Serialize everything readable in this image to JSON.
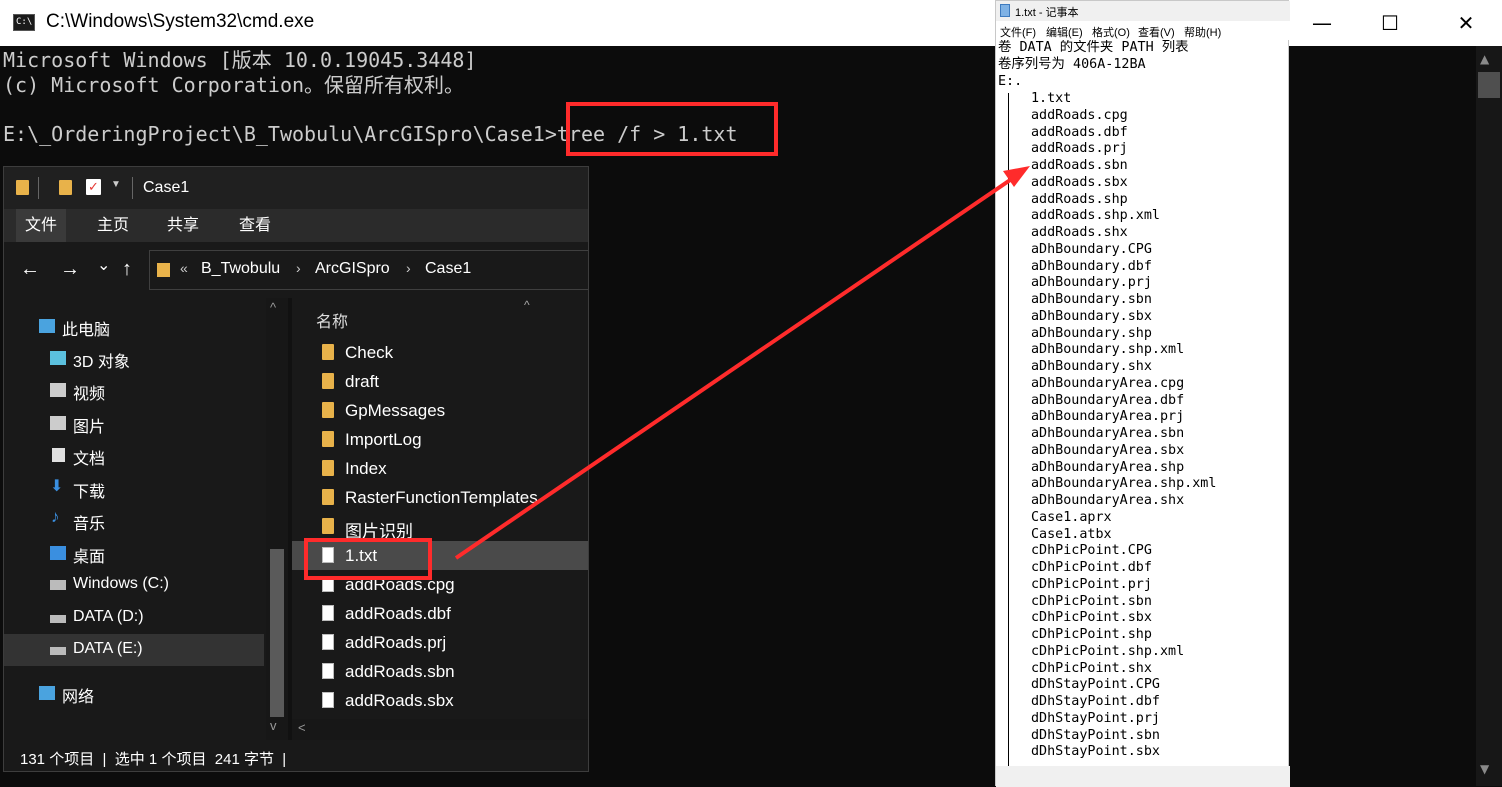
{
  "cmd": {
    "title": "C:\\Windows\\System32\\cmd.exe",
    "icon_text": "C:\\",
    "lines": [
      "Microsoft Windows [版本 10.0.19045.3448]",
      "(c) Microsoft Corporation。保留所有权利。",
      "",
      "E:\\_OrderingProject\\B_Twobulu\\ArcGISpro\\Case1>tree /f > 1.txt"
    ],
    "minimize": "—",
    "maximize": "☐",
    "close": "✕"
  },
  "explorer": {
    "title": "Case1",
    "ribbon": {
      "file": "文件",
      "home": "主页",
      "share": "共享",
      "view": "查看"
    },
    "nav": {
      "back": "←",
      "forward": "→",
      "recent": "⌄",
      "up": "↑"
    },
    "address": {
      "overflow": "«",
      "crumbs": [
        "B_Twobulu",
        "ArcGISpro",
        "Case1"
      ]
    },
    "nav_pane": [
      {
        "label": "此电脑",
        "icon": "pc-icon",
        "color": "#4aa3df"
      },
      {
        "label": "3D 对象",
        "icon": "3d-objects-icon",
        "color": "#5bc0de"
      },
      {
        "label": "视频",
        "icon": "video-icon",
        "color": "#cccccc"
      },
      {
        "label": "图片",
        "icon": "pictures-icon",
        "color": "#cccccc"
      },
      {
        "label": "文档",
        "icon": "documents-icon",
        "color": "#e0e0e0"
      },
      {
        "label": "下载",
        "icon": "downloads-icon",
        "color": "#3a8fe0"
      },
      {
        "label": "音乐",
        "icon": "music-icon",
        "color": "#3a8fe0"
      },
      {
        "label": "桌面",
        "icon": "desktop-icon",
        "color": "#3a8fe0"
      },
      {
        "label": "Windows (C:)",
        "icon": "drive-c-icon",
        "color": "#bbbbbb"
      },
      {
        "label": "DATA (D:)",
        "icon": "drive-d-icon",
        "color": "#bbbbbb"
      },
      {
        "label": "DATA (E:)",
        "icon": "drive-e-icon",
        "color": "#bbbbbb"
      },
      {
        "label": "网络",
        "icon": "network-icon",
        "color": "#4aa3df"
      }
    ],
    "column_name": "名称",
    "files": [
      {
        "name": "Check",
        "type": "folder"
      },
      {
        "name": "draft",
        "type": "folder"
      },
      {
        "name": "GpMessages",
        "type": "folder"
      },
      {
        "name": "ImportLog",
        "type": "folder"
      },
      {
        "name": "Index",
        "type": "folder"
      },
      {
        "name": "RasterFunctionTemplates",
        "type": "folder"
      },
      {
        "name": "图片识别",
        "type": "folder"
      },
      {
        "name": "1.txt",
        "type": "text"
      },
      {
        "name": "addRoads.cpg",
        "type": "file"
      },
      {
        "name": "addRoads.dbf",
        "type": "file"
      },
      {
        "name": "addRoads.prj",
        "type": "file"
      },
      {
        "name": "addRoads.sbn",
        "type": "file"
      },
      {
        "name": "addRoads.sbx",
        "type": "file"
      }
    ],
    "status": "131 个项目  |  选中 1 个项目  241 字节  |"
  },
  "notepad": {
    "title": "1.txt - 记事本",
    "menu": [
      "文件(F)",
      "编辑(E)",
      "格式(O)",
      "查看(V)",
      "帮助(H)"
    ],
    "header_lines": [
      "卷 DATA 的文件夹 PATH 列表",
      "卷序列号为 406A-12BA",
      "E:."
    ],
    "files": [
      "1.txt",
      "addRoads.cpg",
      "addRoads.dbf",
      "addRoads.prj",
      "addRoads.sbn",
      "addRoads.sbx",
      "addRoads.shp",
      "addRoads.shp.xml",
      "addRoads.shx",
      "aDhBoundary.CPG",
      "aDhBoundary.dbf",
      "aDhBoundary.prj",
      "aDhBoundary.sbn",
      "aDhBoundary.sbx",
      "aDhBoundary.shp",
      "aDhBoundary.shp.xml",
      "aDhBoundary.shx",
      "aDhBoundaryArea.cpg",
      "aDhBoundaryArea.dbf",
      "aDhBoundaryArea.prj",
      "aDhBoundaryArea.sbn",
      "aDhBoundaryArea.sbx",
      "aDhBoundaryArea.shp",
      "aDhBoundaryArea.shp.xml",
      "aDhBoundaryArea.shx",
      "Case1.aprx",
      "Case1.atbx",
      "cDhPicPoint.CPG",
      "cDhPicPoint.dbf",
      "cDhPicPoint.prj",
      "cDhPicPoint.sbn",
      "cDhPicPoint.sbx",
      "cDhPicPoint.shp",
      "cDhPicPoint.shp.xml",
      "cDhPicPoint.shx",
      "dDhStayPoint.CPG",
      "dDhStayPoint.dbf",
      "dDhStayPoint.prj",
      "dDhStayPoint.sbn",
      "dDhStayPoint.sbx"
    ]
  },
  "colors": {
    "highlight": "#ff2b2b",
    "folder": "#e8b24a"
  }
}
